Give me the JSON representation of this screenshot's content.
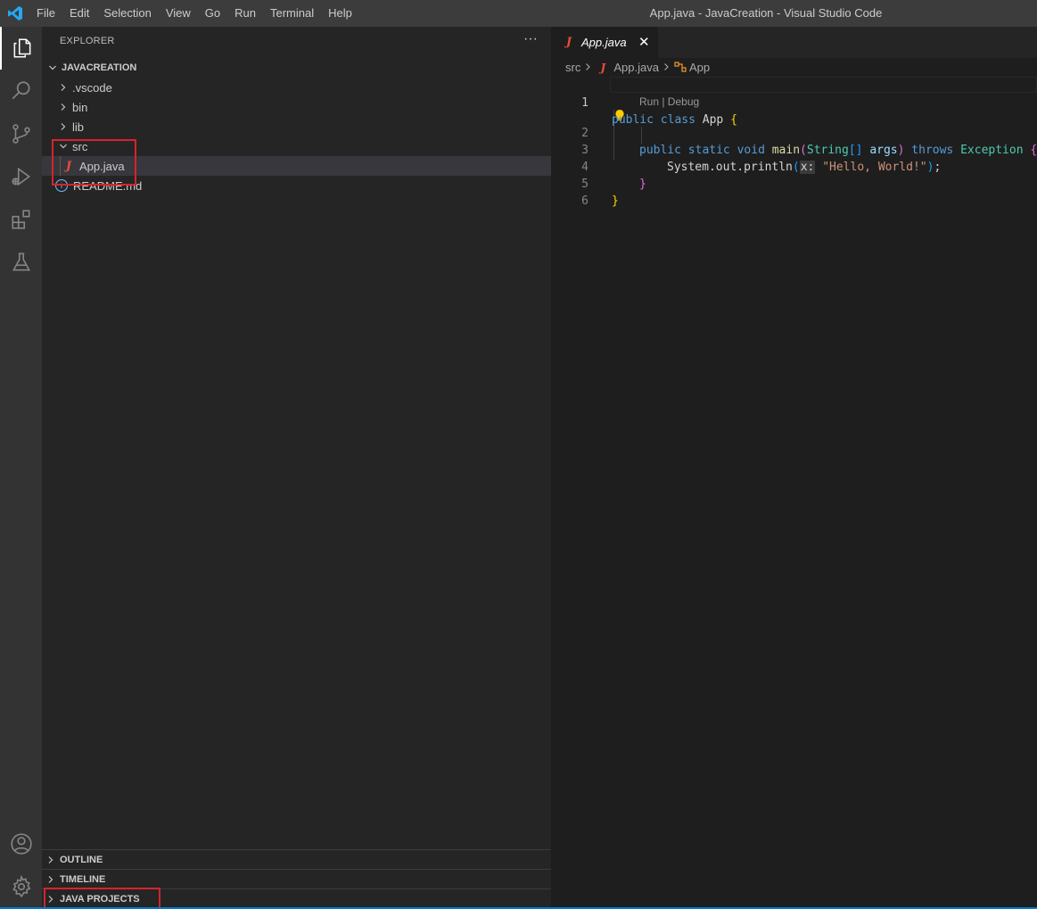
{
  "titlebar": {
    "menu": [
      "File",
      "Edit",
      "Selection",
      "View",
      "Go",
      "Run",
      "Terminal",
      "Help"
    ],
    "window_title": "App.java - JavaCreation - Visual Studio Code"
  },
  "activitybar": {
    "icons": [
      "explorer-icon",
      "search-icon",
      "source-control-icon",
      "run-debug-icon",
      "extensions-icon",
      "testing-icon",
      "account-icon",
      "manage-gear-icon"
    ]
  },
  "sidebar": {
    "header": "EXPLORER",
    "more": "···",
    "project": "JAVACREATION",
    "tree": {
      "vscode": ".vscode",
      "bin": "bin",
      "lib": "lib",
      "src": "src",
      "app_java": "App.java",
      "readme": "README.md"
    },
    "java_letter": "J",
    "info_letter": "i",
    "sections": {
      "outline": "OUTLINE",
      "timeline": "TIMELINE",
      "java_projects": "JAVA PROJECTS"
    }
  },
  "editor": {
    "tab": {
      "label": "App.java",
      "close": "✕",
      "icon_letter": "J"
    },
    "breadcrumb": {
      "folder": "src",
      "file": "App.java",
      "symbol": "App"
    },
    "codelens": "Run | Debug",
    "line_numbers": [
      "1",
      "2",
      "3",
      "4",
      "5",
      "6"
    ],
    "code": {
      "l1_public": "public",
      "l1_class": "class",
      "l1_name": "App",
      "l1_brace": "{",
      "l2_public": "public",
      "l2_static": "static",
      "l2_void": "void",
      "l2_main": "main",
      "l2_paren_open": "(",
      "l2_type": "String",
      "l2_brackets": "[]",
      "l2_args": "args",
      "l2_paren_close": ")",
      "l2_throws": "throws",
      "l2_exception": "Exception",
      "l2_brace": "{",
      "l3_call": "System.out.println",
      "l3_paren_open": "(",
      "l3_hint": "x:",
      "l3_string": "\"Hello, World!\"",
      "l3_paren_close": ")",
      "l3_semicolon": ";",
      "l4_brace": "}",
      "l5_brace": "}"
    }
  },
  "colors": {
    "accent": "#007acc",
    "highlight_box": "#d3252b",
    "java_icon": "#e74c3c"
  }
}
